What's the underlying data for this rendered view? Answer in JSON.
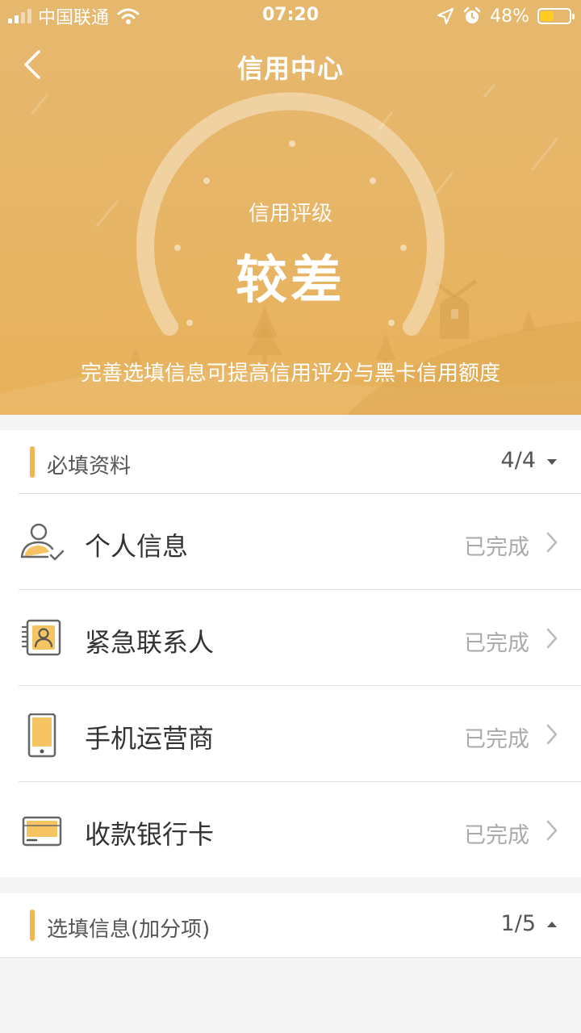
{
  "status_bar": {
    "carrier": "中国联通",
    "time": "07:20",
    "battery": "48%",
    "battery_level": 0.48,
    "icons": [
      "signal-icon",
      "wifi-icon",
      "location-icon",
      "alarm-icon",
      "battery-icon"
    ]
  },
  "nav": {
    "title": "信用中心",
    "back_icon": "chevron-left-icon"
  },
  "credit": {
    "label": "信用评级",
    "value": "较差",
    "hint": "完善选填信息可提高信用评分与黑卡信用额度"
  },
  "required_section": {
    "title": "必填资料",
    "count": "4/4",
    "toggle_icon": "caret-down-icon",
    "items": [
      {
        "label": "个人信息",
        "status": "已完成",
        "icon": "user-check-icon"
      },
      {
        "label": "紧急联系人",
        "status": "已完成",
        "icon": "contact-card-icon"
      },
      {
        "label": "手机运营商",
        "status": "已完成",
        "icon": "mobile-phone-icon"
      },
      {
        "label": "收款银行卡",
        "status": "已完成",
        "icon": "bank-card-icon"
      }
    ]
  },
  "optional_section": {
    "title": "选填信息(加分项)",
    "count": "1/5",
    "toggle_icon": "caret-up-icon"
  },
  "colors": {
    "header_gradient_top": "#e6b86e",
    "header_gradient_bottom": "#e8b25b",
    "accent": "#f2b650",
    "icon_fill": "#f6c463",
    "text_primary": "#333333",
    "text_secondary": "#555555",
    "text_muted": "#aaaaaa"
  }
}
